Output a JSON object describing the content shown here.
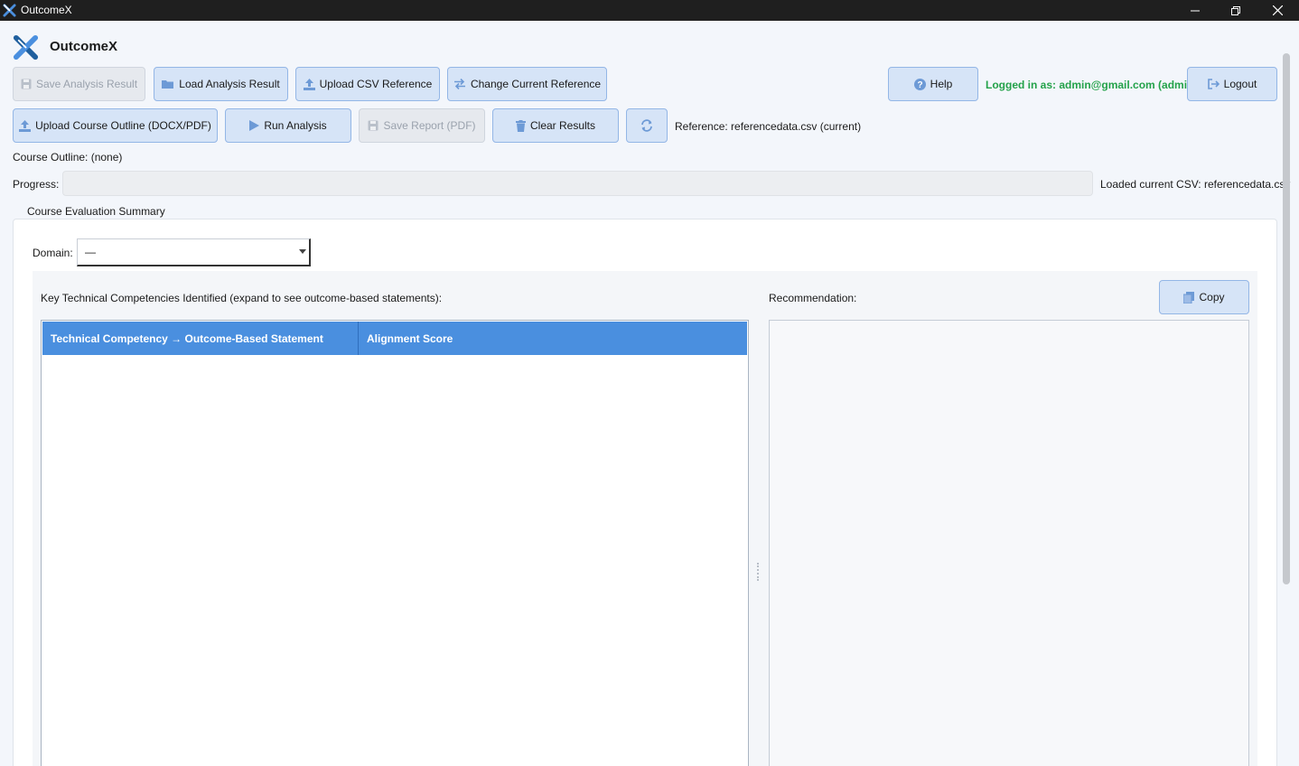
{
  "window": {
    "title": "OutcomeX"
  },
  "brand": {
    "name": "OutcomeX"
  },
  "toolbar": {
    "save_analysis_result": "Save Analysis Result",
    "load_analysis_result": "Load Analysis Result",
    "upload_csv_reference": "Upload CSV Reference",
    "change_current_reference": "Change Current Reference",
    "help": "Help",
    "logout": "Logout",
    "upload_course_outline": "Upload Course Outline (DOCX/PDF)",
    "run_analysis": "Run Analysis",
    "save_report_pdf": "Save Report (PDF)",
    "clear_results": "Clear Results"
  },
  "session": {
    "logged_in_text": "Logged in as: admin@gmail.com (admin)"
  },
  "reference": {
    "text": "Reference:  referencedata.csv (current)"
  },
  "course_outline": {
    "text": "Course Outline: (none)"
  },
  "progress": {
    "label": "Progress:",
    "value": 0,
    "status_text": "Loaded current CSV: referencedata.csv"
  },
  "summary": {
    "group_title": "Course Evaluation Summary",
    "domain_label": "Domain:",
    "domain_selected": "—",
    "competencies_label": "Key Technical Competencies Identified (expand to see outcome-based statements):",
    "columns": [
      "Technical Competency → Outcome-Based Statement",
      "Alignment Score"
    ],
    "rows": [],
    "recommendation_label": "Recommendation:",
    "copy_button": "Copy",
    "recommendation_text": ""
  },
  "colors": {
    "accent": "#4a8fdf",
    "button_bg": "#d6e4f7",
    "button_border": "#93b6e6",
    "logged_in": "#24a24a",
    "titlebar": "#1f1f1f"
  },
  "icons": {
    "save": "floppy-icon",
    "load": "folder-icon",
    "upload": "upload-icon",
    "change": "swap-arrows-icon",
    "help": "question-circle-icon",
    "logout": "sign-out-icon",
    "run": "play-icon",
    "clear": "trash-icon",
    "refresh": "refresh-icon",
    "copy": "copy-icon"
  }
}
